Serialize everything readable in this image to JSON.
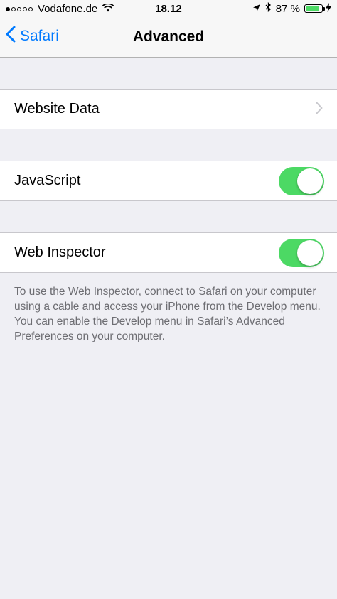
{
  "status_bar": {
    "carrier": "Vodafone.de",
    "time": "18.12",
    "battery_percent": "87 %",
    "battery_level": 0.87,
    "signal_strength_dots": 1,
    "icons": [
      "wifi-icon",
      "location-arrow-icon",
      "bluetooth-icon",
      "battery-icon",
      "charging-bolt-icon"
    ]
  },
  "nav": {
    "back_label": "Safari",
    "title": "Advanced"
  },
  "sections": {
    "website_data": {
      "label": "Website Data"
    },
    "javascript": {
      "label": "JavaScript",
      "enabled": true
    },
    "web_inspector": {
      "label": "Web Inspector",
      "enabled": true
    }
  },
  "footer_note": "To use the Web Inspector, connect to Safari on your computer using a cable and access your iPhone from the Develop menu. You can enable the Develop menu in Safari’s Advanced Preferences on your computer.",
  "colors": {
    "accent": "#007aff",
    "toggle_on": "#4cd964",
    "background": "#efeff4",
    "footer_text": "#6d6d72"
  }
}
